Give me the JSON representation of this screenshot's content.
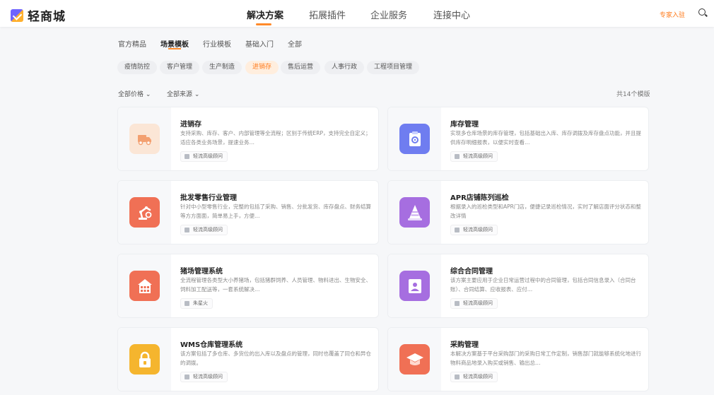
{
  "header": {
    "logo_text": "轻商城",
    "nav": [
      "解决方案",
      "拓展插件",
      "企业服务",
      "连接中心"
    ],
    "expert_link": "专家入驻"
  },
  "tabs": [
    "官方精品",
    "场景模板",
    "行业模板",
    "基础入门",
    "全部"
  ],
  "chips": [
    "疫情防控",
    "客户管理",
    "生产制造",
    "进销存",
    "售后运营",
    "人事行政",
    "工程项目管理"
  ],
  "filters": {
    "price": "全部价格",
    "source": "全部来源",
    "count": "共14个模版"
  },
  "cards": [
    {
      "title": "进销存",
      "desc": "支持采购、库存、客户、内部管理等全流程；区别于传统ERP，支持完全自定义；适应各类业务场景，提速业务…",
      "tag": "轻流高级顾问",
      "icon": "truck-icon",
      "color": "#fbe6d6"
    },
    {
      "title": "库存管理",
      "desc": "实现多仓库场景的库存管理，包括基础出入库、库存调拨及库存盘点功能，并且提供库存明细报表，以便实时查看…",
      "tag": "轻流高级顾问",
      "icon": "clipboard-icon",
      "color": "#6f7df0"
    },
    {
      "title": "批发零售行业管理",
      "desc": "针对中小型零售行业，完整的包括了采购、销售、分批发货、库存盘点、财务结算等方方面面，简单易上手，方便…",
      "tag": "轻流高级顾问",
      "icon": "robot-arm-icon",
      "color": "#f07055"
    },
    {
      "title": "APR店铺陈列巡检",
      "desc": "根据录入的巡检类型和APR门店，便捷记录巡检情况，实时了解店面评分状态和整改详情",
      "tag": "轻流高级顾问",
      "icon": "cone-icon",
      "color": "#a66ee0"
    },
    {
      "title": "猪场管理系统",
      "desc": "全流程管理各类型大小养猪场，包括猪群饲养、人员管理、物料进出、生物安全、饲料加工配送等，一套系统解决…",
      "tag": "朱星火",
      "icon": "barn-icon",
      "color": "#f07055"
    },
    {
      "title": "综合合同管理",
      "desc": "该方案主要应用于企业日常运营过程中的合同管理，包括合同信息录入（合同台账）、合同结算、应收报表、应付…",
      "tag": "轻流高级顾问",
      "icon": "contract-icon",
      "color": "#a66ee0"
    },
    {
      "title": "WMS仓库管理系统",
      "desc": "该方案包括了多仓库、多货位的出入库以及盘点的管理，同时也覆盖了同仓和异仓的调拨。",
      "tag": "轻流高级顾问",
      "icon": "lock-box-icon",
      "color": "#f5b52e"
    },
    {
      "title": "采购管理",
      "desc": "本解决方案基于平台采购部门的采购日常工作定制，销售部门就能够系统化地进行物料商品地录入购买或销售、输出总…",
      "tag": "轻流高级顾问",
      "icon": "graduation-cap-icon",
      "color": "#f07055"
    }
  ]
}
